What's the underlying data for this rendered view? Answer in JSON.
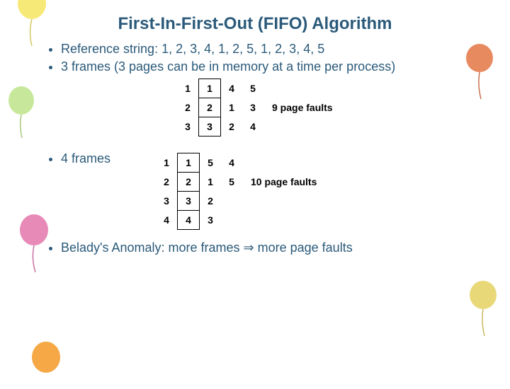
{
  "title": "First-In-First-Out (FIFO) Algorithm",
  "bullets": {
    "b1": "Reference string: 1, 2, 3, 4, 1, 2, 5, 1, 2, 3, 4, 5",
    "b2": "3 frames (3 pages can be in memory at a time per process)",
    "b3": "4 frames",
    "b4": "Belady's Anomaly: more frames ⇒ more page faults"
  },
  "table3": {
    "rows": [
      [
        "1",
        "1",
        "4",
        "5"
      ],
      [
        "2",
        "2",
        "1",
        "3"
      ],
      [
        "3",
        "3",
        "2",
        "4"
      ]
    ],
    "fault_label": "9 page faults"
  },
  "table4": {
    "rows": [
      [
        "1",
        "1",
        "5",
        "4"
      ],
      [
        "2",
        "2",
        "1",
        "5"
      ],
      [
        "3",
        "3",
        "2",
        ""
      ],
      [
        "4",
        "4",
        "3",
        ""
      ]
    ],
    "fault_label": "10 page faults"
  }
}
